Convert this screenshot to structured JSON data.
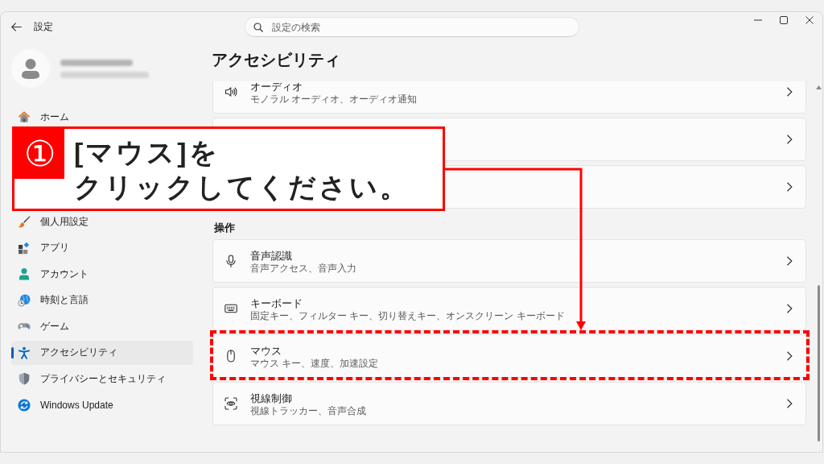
{
  "window": {
    "title": "設定"
  },
  "search": {
    "placeholder": "設定の検索"
  },
  "sidebar": {
    "items": [
      {
        "kind": "home",
        "label": "ホーム",
        "selected": false
      },
      {
        "kind": "personalization",
        "label": "個人用設定",
        "selected": false
      },
      {
        "kind": "apps",
        "label": "アプリ",
        "selected": false
      },
      {
        "kind": "accounts",
        "label": "アカウント",
        "selected": false
      },
      {
        "kind": "time-language",
        "label": "時刻と言語",
        "selected": false
      },
      {
        "kind": "gaming",
        "label": "ゲーム",
        "selected": false
      },
      {
        "kind": "accessibility",
        "label": "アクセシビリティ",
        "selected": true
      },
      {
        "kind": "privacy",
        "label": "プライバシーとセキュリティ",
        "selected": false
      },
      {
        "kind": "update",
        "label": "Windows Update",
        "selected": false
      }
    ]
  },
  "page_title": "アクセシビリティ",
  "sections": [
    {
      "rows": [
        {
          "kind": "audio",
          "title": "オーディオ",
          "subtitle": "モノラル オーディオ、オーディオ通知",
          "highlighted": false
        },
        {
          "kind": "covered",
          "highlighted": false
        },
        {
          "kind": "covered",
          "highlighted": false
        }
      ]
    },
    {
      "heading": "操作",
      "rows": [
        {
          "kind": "speech",
          "title": "音声認識",
          "subtitle": "音声アクセス、音声入力",
          "highlighted": false
        },
        {
          "kind": "keyboard",
          "title": "キーボード",
          "subtitle": "固定キー、フィルター キー、切り替えキー、オンスクリーン キーボード",
          "highlighted": false
        },
        {
          "kind": "mouse",
          "title": "マウス",
          "subtitle": "マウス キー、速度、加速設定",
          "highlighted": true
        },
        {
          "kind": "eye-control",
          "title": "視線制御",
          "subtitle": "視線トラッカー、音声合成",
          "highlighted": false
        }
      ]
    }
  ],
  "callout": {
    "number": "①",
    "lines": [
      "[マウス]を",
      "クリックしてください。"
    ]
  }
}
